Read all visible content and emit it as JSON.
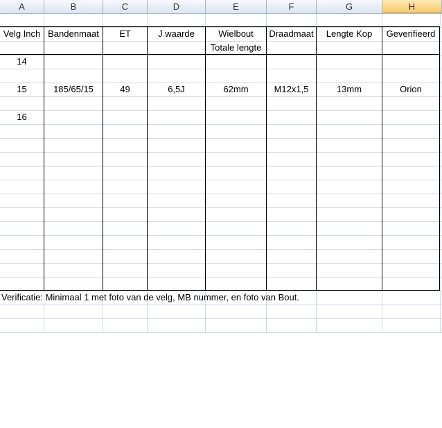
{
  "columns": [
    "A",
    "B",
    "C",
    "D",
    "E",
    "F",
    "G",
    "H"
  ],
  "selected_column": "H",
  "header": {
    "velg_inch": "Velg Inch",
    "bandenmaat": "Bandenmaat",
    "et": "ET",
    "j_waarde": "J waarde",
    "wielbout": "Wielbout",
    "totale_lengte": "Totale lengte",
    "draadmaat": "Draadmaat",
    "lengte_kop": "Lengte Kop",
    "geverifieerd": "Geverifieerd"
  },
  "rows": [
    {
      "velg_inch": "14"
    },
    {
      "velg_inch": "15",
      "bandenmaat": "185/65/15",
      "et": "49",
      "j_waarde": "6,5J",
      "wielbout_lengte": "62mm",
      "draadmaat": "M12x1,5",
      "lengte_kop": "13mm",
      "geverifieerd": "Orion"
    },
    {
      "velg_inch": "16"
    }
  ],
  "note": "Verificatie: Minimaal 1 met foto van de velg, MB nummer, en foto van Bout."
}
